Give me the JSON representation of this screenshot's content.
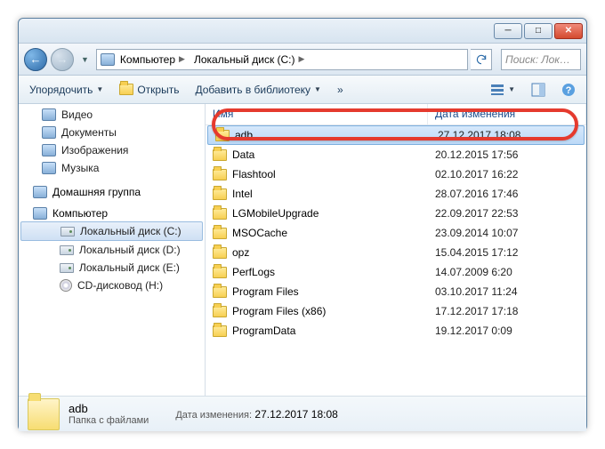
{
  "breadcrumb": {
    "root": "Компьютер",
    "drive": "Локальный диск (C:)"
  },
  "search": {
    "placeholder": "Поиск: Лок…"
  },
  "toolbar": {
    "organize": "Упорядочить",
    "open": "Открыть",
    "add_library": "Добавить в библиотеку",
    "overflow": "»"
  },
  "navpane": {
    "video": "Видео",
    "documents": "Документы",
    "images": "Изображения",
    "music": "Музыка",
    "homegroup": "Домашняя группа",
    "computer": "Компьютер",
    "drive_c": "Локальный диск (C:)",
    "drive_d": "Локальный диск (D:)",
    "drive_e": "Локальный диск (E:)",
    "cd_h": "CD-дисковод (H:)"
  },
  "columns": {
    "name": "Имя",
    "date": "Дата изменения"
  },
  "files": [
    {
      "name": "adb",
      "date": "27.12.2017 18:08",
      "selected": true
    },
    {
      "name": "Data",
      "date": "20.12.2015 17:56"
    },
    {
      "name": "Flashtool",
      "date": "02.10.2017 16:22"
    },
    {
      "name": "Intel",
      "date": "28.07.2016 17:46"
    },
    {
      "name": "LGMobileUpgrade",
      "date": "22.09.2017 22:53"
    },
    {
      "name": "MSOCache",
      "date": "23.09.2014 10:07"
    },
    {
      "name": "opz",
      "date": "15.04.2015 17:12"
    },
    {
      "name": "PerfLogs",
      "date": "14.07.2009 6:20"
    },
    {
      "name": "Program Files",
      "date": "03.10.2017 11:24"
    },
    {
      "name": "Program Files (x86)",
      "date": "17.12.2017 17:18"
    },
    {
      "name": "ProgramData",
      "date": "19.12.2017 0:09"
    }
  ],
  "details": {
    "name": "adb",
    "type": "Папка с файлами",
    "date_label": "Дата изменения:",
    "date_value": "27.12.2017 18:08"
  }
}
